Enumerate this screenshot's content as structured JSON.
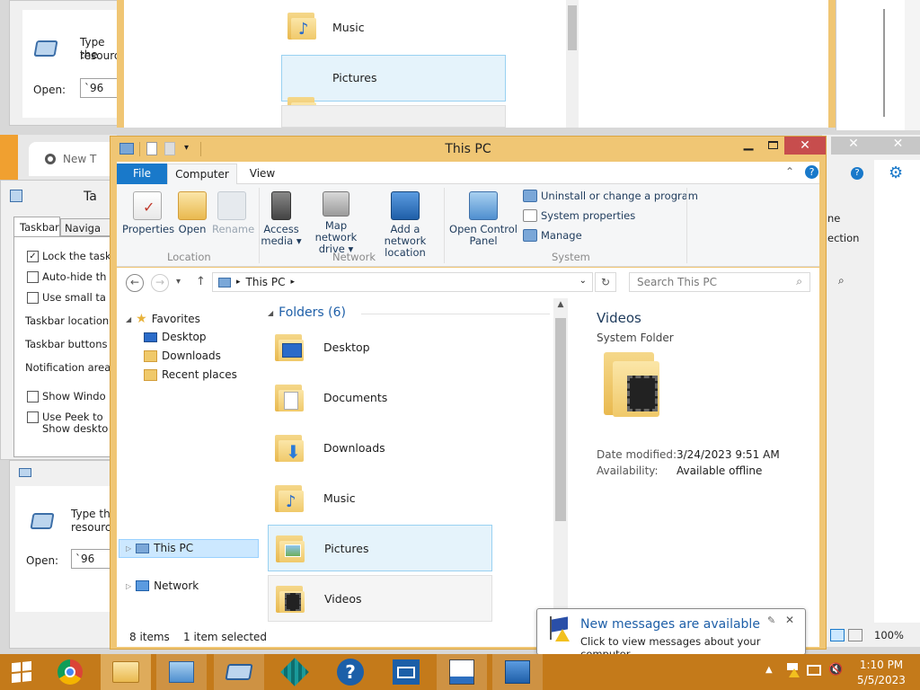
{
  "explorer": {
    "title": "This PC",
    "tabs": [
      {
        "label": "File"
      },
      {
        "label": "Computer"
      },
      {
        "label": "View"
      }
    ],
    "ribbon": {
      "location": {
        "label": "Location",
        "properties": "Properties",
        "open": "Open",
        "rename": "Rename"
      },
      "network": {
        "label": "Network",
        "access_media": [
          "Access",
          "media ▾"
        ],
        "map_drive": [
          "Map network",
          "drive ▾"
        ],
        "add_location": [
          "Add a network",
          "location"
        ]
      },
      "system": {
        "label": "System",
        "open_cp": [
          "Open Control",
          "Panel"
        ],
        "uninstall": "Uninstall or change a program",
        "sys_props": "System properties",
        "manage": "Manage"
      }
    },
    "address": {
      "path": "This PC",
      "search_placeholder": "Search This PC"
    },
    "nav": {
      "favorites": "Favorites",
      "desktop": "Desktop",
      "downloads": "Downloads",
      "recent": "Recent places",
      "this_pc": "This PC",
      "network": "Network"
    },
    "folders_header": "Folders (6)",
    "folders": [
      "Desktop",
      "Documents",
      "Downloads",
      "Music",
      "Pictures",
      "Videos"
    ],
    "selected_folder": "Pictures",
    "details": {
      "name": "Videos",
      "type": "System Folder",
      "date_label": "Date modified:",
      "date_value": "3/24/2023 9:51 AM",
      "avail_label": "Availability:",
      "avail_value": "Available offline"
    },
    "status": {
      "items": "8 items",
      "selected": "1 item selected"
    }
  },
  "background": {
    "top_window": {
      "music": "Music",
      "pictures": "Pictures"
    },
    "run_dialog_top": {
      "text": "Type the",
      "text2": "resource",
      "open_label": "Open:",
      "open_value": "`96"
    },
    "run_dialog_bottom": {
      "text": "Type the",
      "text2": "resource",
      "open_label": "Open:",
      "open_value": "`96"
    },
    "chrome_tab": "New T",
    "taskbar_props": {
      "title": "Ta",
      "tab1": "Taskbar",
      "tab2": "Naviga",
      "lock": "Lock the task",
      "autohide": "Auto-hide th",
      "small": "Use small ta",
      "location": "Taskbar location",
      "buttons": "Taskbar buttons",
      "notif": "Notification area",
      "show_windows": "Show Windo",
      "peek1": "Use Peek to",
      "peek2": "Show deskto"
    },
    "right_panel": {
      "ne": "ne",
      "ection": "ection",
      "zoom": "100%"
    }
  },
  "notification": {
    "title": "New messages are available",
    "body": "Click to view messages about your computer."
  },
  "tray": {
    "time": "1:10 PM",
    "date": "5/5/2023"
  },
  "colors": {
    "frame": "#f0c674",
    "file_tab": "#1979ca",
    "selection": "#cce8ff",
    "taskbar": "#c47a1a",
    "link": "#1e3b5c",
    "heading": "#1e5fa8"
  }
}
